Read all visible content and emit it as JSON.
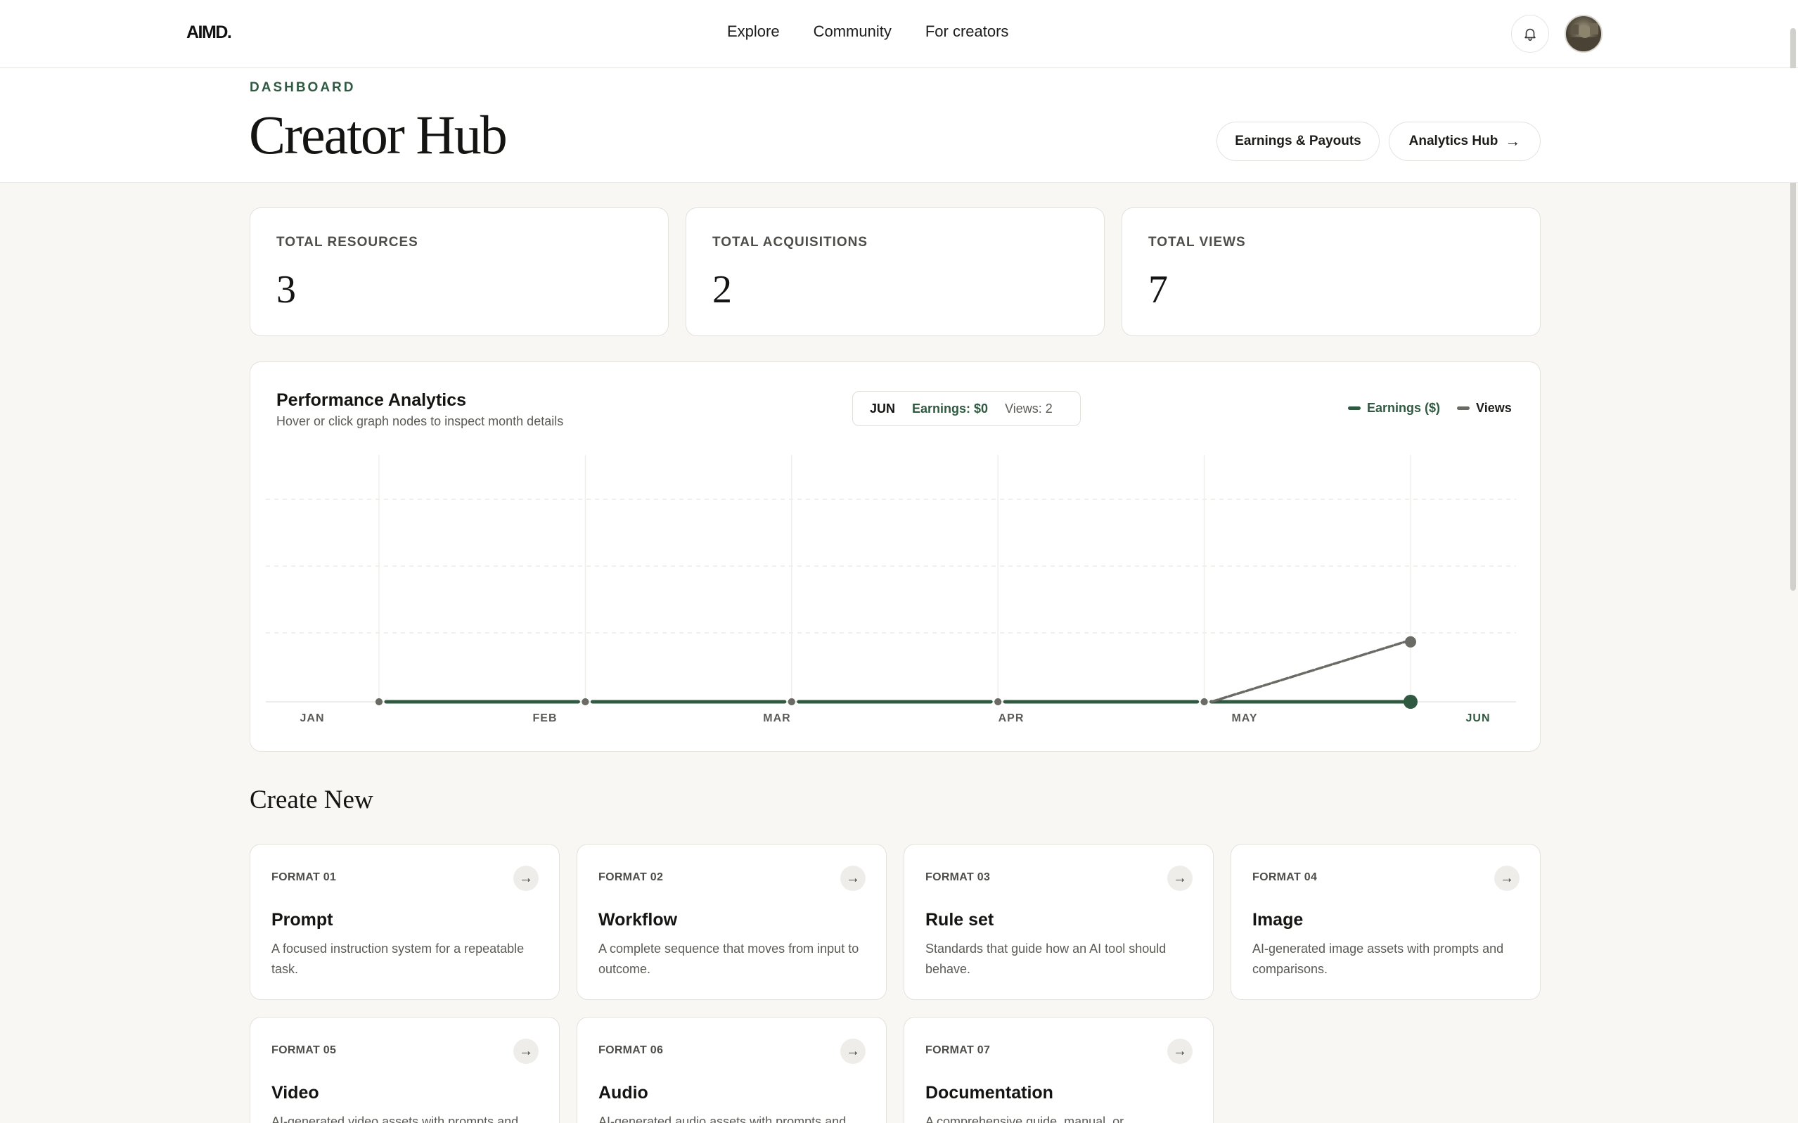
{
  "nav": {
    "logo": "AIMD.",
    "links": [
      "Explore",
      "Community",
      "For creators"
    ]
  },
  "header": {
    "eyebrow": "DASHBOARD",
    "title": "Creator Hub",
    "earnings_button": "Earnings & Payouts",
    "analytics_button": "Analytics Hub",
    "arrow": "→"
  },
  "stats": [
    {
      "label": "TOTAL RESOURCES",
      "value": "3"
    },
    {
      "label": "TOTAL ACQUISITIONS",
      "value": "2"
    },
    {
      "label": "TOTAL VIEWS",
      "value": "7"
    }
  ],
  "analytics": {
    "title": "Performance Analytics",
    "subtitle": "Hover or click graph nodes to inspect month details",
    "selected": {
      "month": "JUN",
      "earnings": "Earnings: $0",
      "views": "Views: 2"
    },
    "legend": [
      {
        "name": "Earnings ($)",
        "color": "#2f5a41"
      },
      {
        "name": "Views",
        "color": "#6b6b65"
      }
    ]
  },
  "chart_data": {
    "type": "line",
    "categories": [
      "JAN",
      "FEB",
      "MAR",
      "APR",
      "MAY",
      "JUN"
    ],
    "series": [
      {
        "name": "Earnings ($)",
        "values": [
          0,
          0,
          0,
          0,
          0,
          0
        ],
        "color": "#2f5a41"
      },
      {
        "name": "Views",
        "values": [
          0,
          0,
          0,
          0,
          0,
          2
        ],
        "color": "#6b6b65"
      }
    ],
    "ylim": [
      0,
      8
    ],
    "grid": true,
    "legend_position": "top-right",
    "selected_index": 5
  },
  "create": {
    "title": "Create New",
    "arrow": "→",
    "formats": [
      {
        "code": "FORMAT 01",
        "name": "Prompt",
        "desc": "A focused instruction system for a repeatable task."
      },
      {
        "code": "FORMAT 02",
        "name": "Workflow",
        "desc": "A complete sequence that moves from input to outcome."
      },
      {
        "code": "FORMAT 03",
        "name": "Rule set",
        "desc": "Standards that guide how an AI tool should behave."
      },
      {
        "code": "FORMAT 04",
        "name": "Image",
        "desc": "AI-generated image assets with prompts and comparisons."
      },
      {
        "code": "FORMAT 05",
        "name": "Video",
        "desc": "AI-generated video assets with prompts and"
      },
      {
        "code": "FORMAT 06",
        "name": "Audio",
        "desc": "AI-generated audio assets with prompts and"
      },
      {
        "code": "FORMAT 07",
        "name": "Documentation",
        "desc": "A comprehensive guide, manual, or"
      }
    ]
  }
}
